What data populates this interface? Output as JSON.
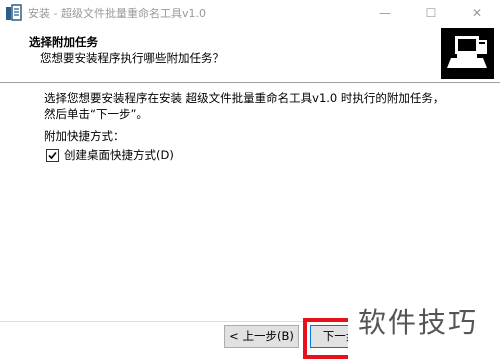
{
  "window": {
    "title": "安装 - 超级文件批量重命名工具v1.0",
    "minimize_glyph": "—",
    "maximize_glyph": "☐",
    "close_glyph": "✕"
  },
  "header": {
    "title": "选择附加任务",
    "subtitle": "您想要安装程序执行哪些附加任务？"
  },
  "body": {
    "description": "选择您想要安装程序在安装 超级文件批量重命名工具v1.0 时执行的附加任务，然后单击“下一步”。",
    "tasks_group_label": "附加快捷方式：",
    "tasks": [
      {
        "label": "创建桌面快捷方式(D)",
        "checked": true
      }
    ]
  },
  "buttons": {
    "back_label": "< 上一步(B)",
    "next_label": "下一步"
  },
  "watermark": {
    "text": "软件技巧"
  },
  "colors": {
    "highlight_border": "#e8101a",
    "focus_border": "#0078d7",
    "button_face": "#e1e1e1"
  }
}
